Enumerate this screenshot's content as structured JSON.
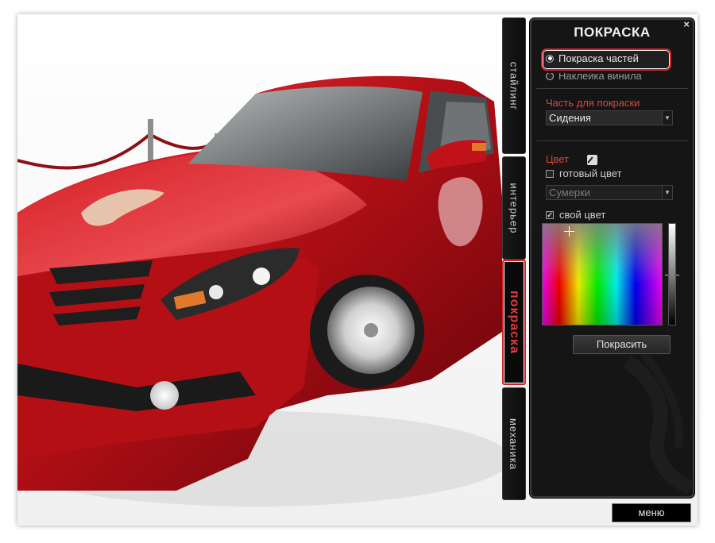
{
  "tabs": [
    {
      "label": "стайлинг",
      "active": false
    },
    {
      "label": "интерьер",
      "active": false
    },
    {
      "label": "покраска",
      "active": true
    },
    {
      "label": "механика",
      "active": false
    }
  ],
  "panel": {
    "title": "ПОКРАСКА",
    "close_glyph": "×",
    "modes": [
      {
        "label": "Покраска частей",
        "selected": true
      },
      {
        "label": "Наклейка винила",
        "selected": false
      }
    ],
    "part_label": "Часть для покраски",
    "part_value": "Сидения",
    "color_label": "Цвет",
    "eyedropper_icon": "eyedropper-icon",
    "ready_color_label": "готовый цвет",
    "ready_color_checked": false,
    "ready_color_value": "Сумерки",
    "own_color_label": "свой цвет",
    "own_color_checked": true,
    "check_glyph": "✓",
    "paint_button": "Покрасить"
  },
  "menu_button": "меню",
  "colors": {
    "accent_red": "#d21f26",
    "label_red": "#e2433d",
    "car_red": "#c0141b",
    "panel_bg": "#151515"
  }
}
